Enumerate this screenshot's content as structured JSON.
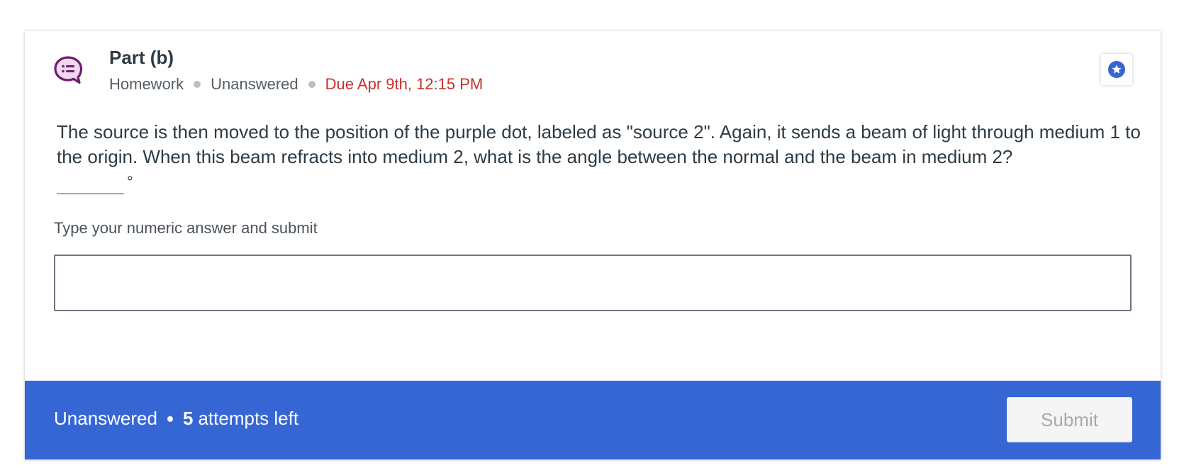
{
  "part": {
    "title": "Part (b)",
    "type": "Homework",
    "status": "Unanswered",
    "due": "Due Apr 9th, 12:15 PM",
    "icon": "question-bubble-icon",
    "icon_color": "#6b1f6b",
    "bookmark_icon": "star-badge-icon",
    "bookmark_color": "#3566d4"
  },
  "question": {
    "text": "The source is then moved to the position of the purple dot, labeled as \"source 2\". Again, it sends a beam of light through medium 1 to the origin. When this beam refracts into medium 2, what is the angle between the normal and the beam in medium 2?",
    "unit": "°"
  },
  "answer": {
    "prompt": "Type your numeric answer and submit",
    "value": "",
    "placeholder": ""
  },
  "footer": {
    "status": "Unanswered",
    "attempts_count": "5",
    "attempts_label": "attempts left",
    "submit_label": "Submit",
    "background": "#3566d4"
  }
}
